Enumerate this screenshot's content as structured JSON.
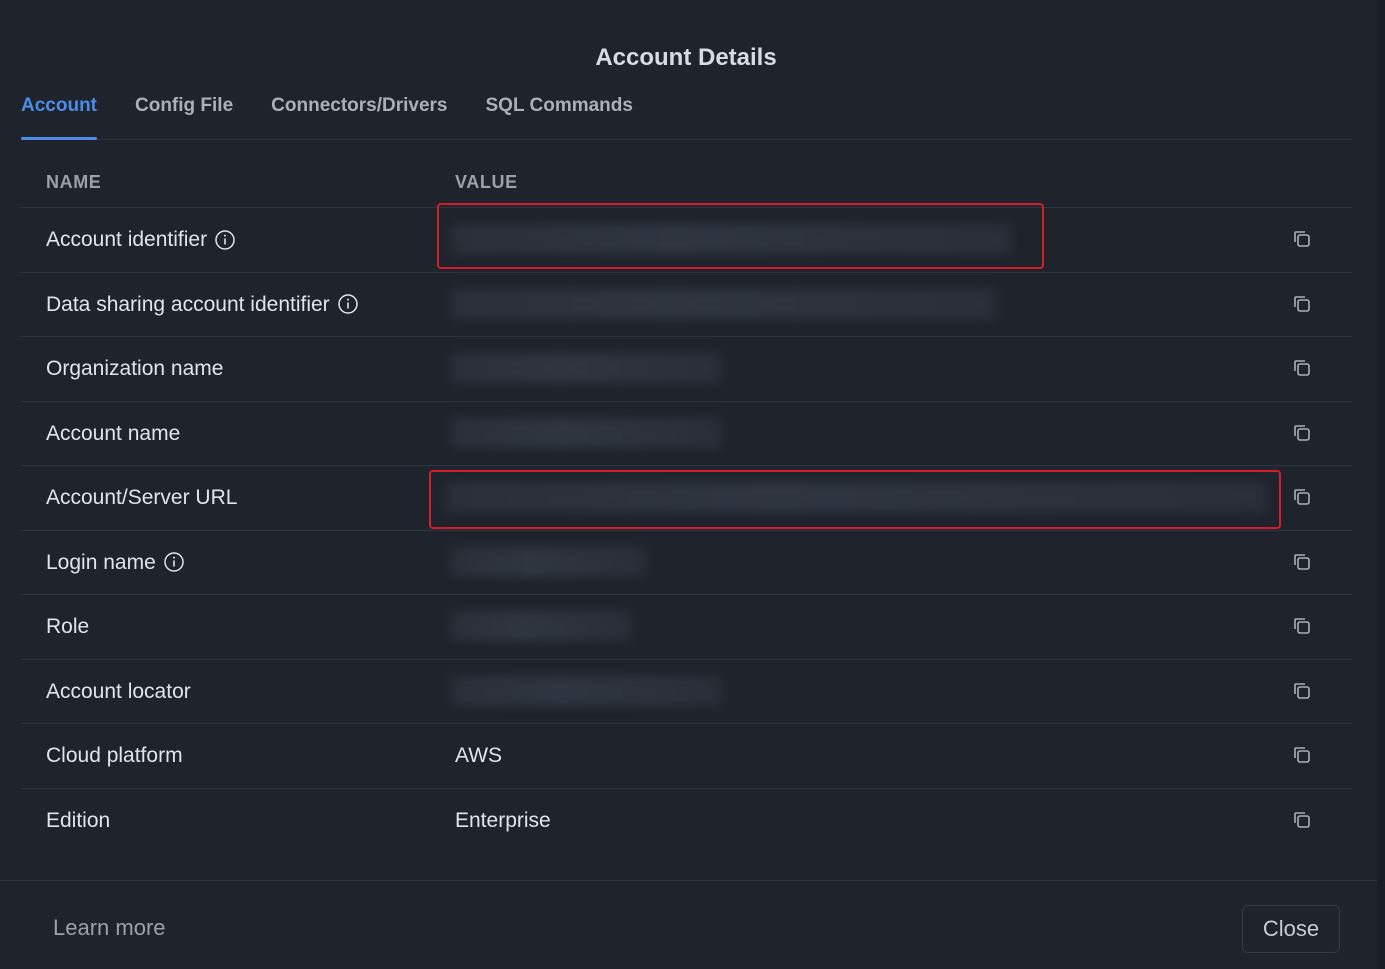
{
  "dialog": {
    "title": "Account Details",
    "tabs": [
      {
        "label": "Account",
        "active": true
      },
      {
        "label": "Config File",
        "active": false
      },
      {
        "label": "Connectors/Drivers",
        "active": false
      },
      {
        "label": "SQL Commands",
        "active": false
      }
    ],
    "table": {
      "headers": {
        "name": "NAME",
        "value": "VALUE"
      },
      "rows": [
        {
          "name": "Account identifier",
          "info": true,
          "value": "",
          "redacted": true
        },
        {
          "name": "Data sharing account identifier",
          "info": true,
          "value": "",
          "redacted": true
        },
        {
          "name": "Organization name",
          "info": false,
          "value": "",
          "redacted": true
        },
        {
          "name": "Account name",
          "info": false,
          "value": "",
          "redacted": true
        },
        {
          "name": "Account/Server URL",
          "info": false,
          "value": "",
          "redacted": true
        },
        {
          "name": "Login name",
          "info": true,
          "value": "",
          "redacted": true
        },
        {
          "name": "Role",
          "info": false,
          "value": "",
          "redacted": true
        },
        {
          "name": "Account locator",
          "info": false,
          "value": "",
          "redacted": true
        },
        {
          "name": "Cloud platform",
          "info": false,
          "value": "AWS",
          "redacted": false
        },
        {
          "name": "Edition",
          "info": false,
          "value": "Enterprise",
          "redacted": false
        }
      ]
    },
    "footer": {
      "learn_more": "Learn more",
      "close_label": "Close"
    }
  },
  "colors": {
    "background": "#1f232c",
    "accent": "#4c8dea",
    "highlight_border": "#d21f2a",
    "text_primary": "#e1e4e8",
    "text_muted": "#9aa1ab"
  },
  "icons": {
    "info": "info-circle-icon",
    "copy": "copy-icon"
  }
}
